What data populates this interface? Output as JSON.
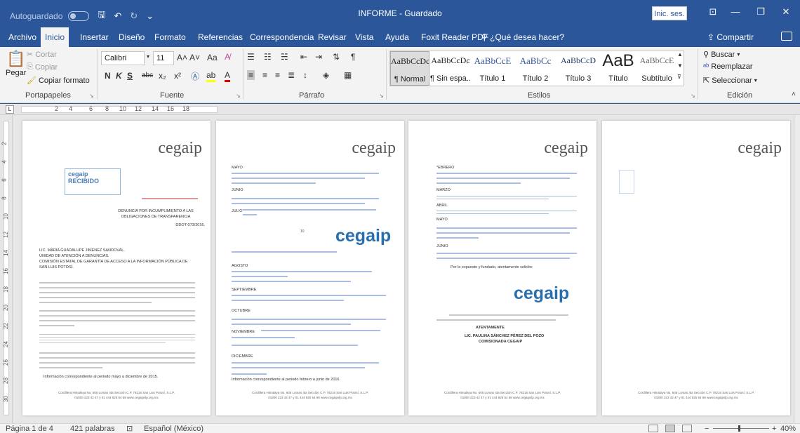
{
  "titlebar": {
    "autosave_label": "Autoguardado",
    "title": "INFORME - Guardado",
    "sign_in": "Inic. ses."
  },
  "tabs": [
    "Archivo",
    "Inicio",
    "Insertar",
    "Diseño",
    "Formato",
    "Referencias",
    "Correspondencia",
    "Revisar",
    "Vista",
    "Ayuda",
    "Foxit Reader PDF"
  ],
  "tell_me": "¿Qué desea hacer?",
  "share": "Compartir",
  "clipboard": {
    "label": "Portapapeles",
    "paste": "Pegar",
    "cut": "Cortar",
    "copy": "Copiar",
    "format_painter": "Copiar formato"
  },
  "font": {
    "label": "Fuente",
    "name": "Calibri",
    "size": "11",
    "bold": "N",
    "italic": "K",
    "underline": "S",
    "strike": "abc",
    "sub": "x₂",
    "sup": "x²",
    "case": "Aa"
  },
  "paragraph": {
    "label": "Párrafo"
  },
  "styles": {
    "label": "Estilos",
    "items": [
      {
        "preview": "AaBbCcDc",
        "name": "¶ Normal"
      },
      {
        "preview": "AaBbCcDc",
        "name": "¶ Sin espa..."
      },
      {
        "preview": "AaBbCcE",
        "name": "Título 1"
      },
      {
        "preview": "AaBbCc",
        "name": "Título 2"
      },
      {
        "preview": "AaBbCcD",
        "name": "Título 3"
      },
      {
        "preview": "AaB",
        "name": "Título"
      },
      {
        "preview": "AaBbCcE",
        "name": "Subtítulo"
      }
    ]
  },
  "editing": {
    "label": "Edición",
    "find": "Buscar",
    "replace": "Reemplazar",
    "select": "Seleccionar"
  },
  "ruler": {
    "numbers": [
      "2",
      "4",
      "6",
      "8",
      "10",
      "12",
      "14",
      "16",
      "18"
    ]
  },
  "vruler": {
    "numbers": [
      "2",
      "4",
      "6",
      "8",
      "10",
      "12",
      "14",
      "16",
      "18",
      "20",
      "22",
      "24",
      "26",
      "28",
      "30"
    ]
  },
  "pages": {
    "logo": "cegaip",
    "p1": {
      "denuncia": "DENUNCIA POR INCUMPLIMIENTO A LAS",
      "obligaciones": "OBLIGACIONES DE TRANSPARENCIA",
      "oficio": "DDOT-073/2016.",
      "recipient1": "LIC. MARIA GUADALUPE JIMENEZ SANDOVAL.",
      "recipient2": "UNIDAD DE ATENCIÓN A DENUNCIAS.",
      "recipient3": "COMISIÓN ESTATAL DE GARANTÍA DE ACCESO A LA INFORMACIÓN PÚBLICA DE",
      "recipient4": "SAN LUIS POTOSÍ.",
      "closing": "Información correspondiente al periodo mayo a diciembre de 2015."
    },
    "p2": {
      "mayo": "MAYO",
      "junio": "JUNIO",
      "julio": "JULIO",
      "agosto": "AGOSTO",
      "septiembre": "SEPTIEMBRE",
      "octubre": "OCTUBRE",
      "noviembre": "NOVIEMBRE",
      "diciembre": "DICIEMBRE",
      "closing": "Información correspondiente al periodo febrero a junio de 2016."
    },
    "p3": {
      "febrero": "*EBRERO",
      "marzo": "MARZO",
      "abril": "ABRIL",
      "mayo": "MAYO",
      "junio": "JUNIO",
      "expuesto": "Por lo expuesto y fundado, atentamente solicito:",
      "atentamente": "ATENTAMENTE",
      "firma1": "LIC. PAULINA SÁNCHEZ PÉREZ DEL POZO",
      "firma2": "COMISIONADA CEGAIP"
    },
    "footer1": "Cordillera Himalaya No. 605 Lomas 4ta Sección C.P. 78216 San Luis Potosí, S.L.P.",
    "footer2": "01800 223 42 47 y 01 444 825 64 68 www.cegaipslp.org.mx"
  },
  "status": {
    "page": "Página 1 de 4",
    "words": "421 palabras",
    "language": "Español (México)",
    "zoom": "40%"
  }
}
